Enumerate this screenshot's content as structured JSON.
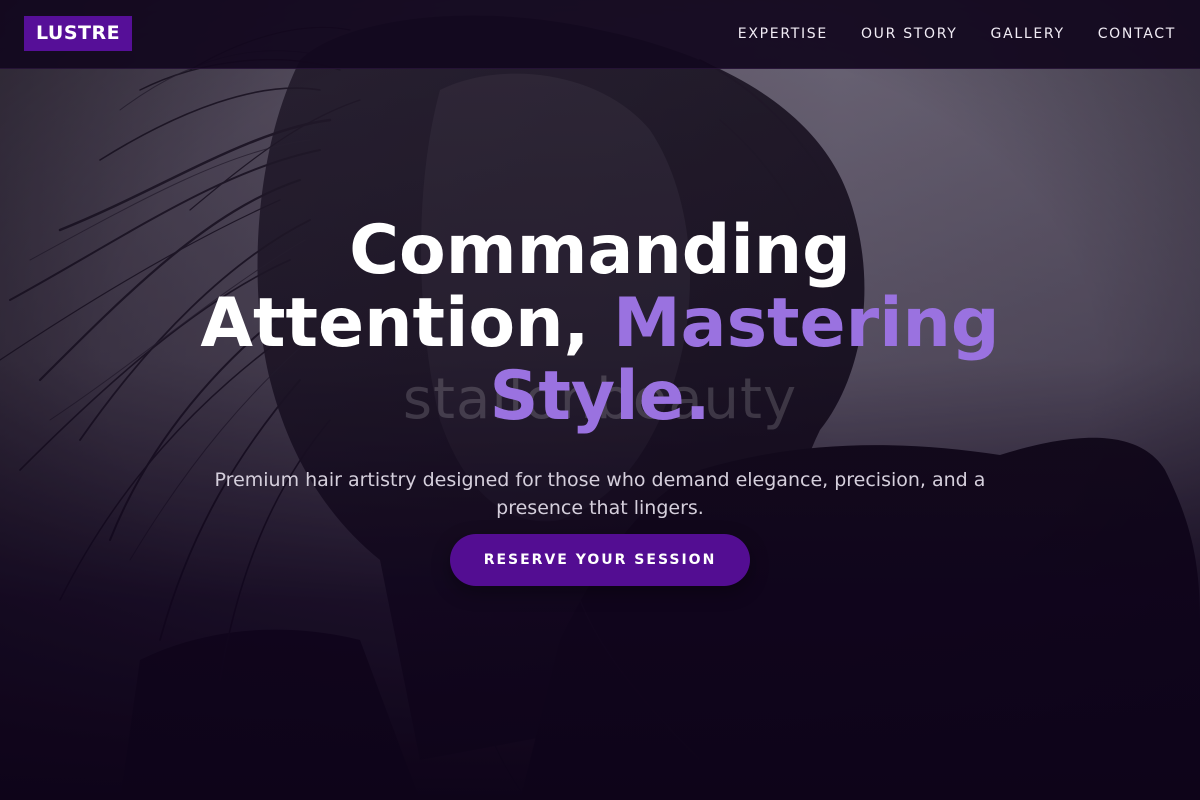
{
  "brand": {
    "logo_text": "LUSTRE",
    "logo_bg": "#560f98"
  },
  "nav": {
    "items": [
      {
        "label": "EXPERTISE"
      },
      {
        "label": "OUR STORY"
      },
      {
        "label": "GALLERY"
      },
      {
        "label": "CONTACT"
      }
    ]
  },
  "hero": {
    "headline_part1": "Commanding Attention, ",
    "headline_accent": "Mastering Style.",
    "accent_color": "#9a72e0",
    "watermark_text": "stallonbeauty",
    "subtitle": "Premium hair artistry designed for those who demand elegance, precision, and a presence that lingers.",
    "cta_label": "RESERVE YOUR SESSION",
    "cta_color": "#530d92"
  }
}
